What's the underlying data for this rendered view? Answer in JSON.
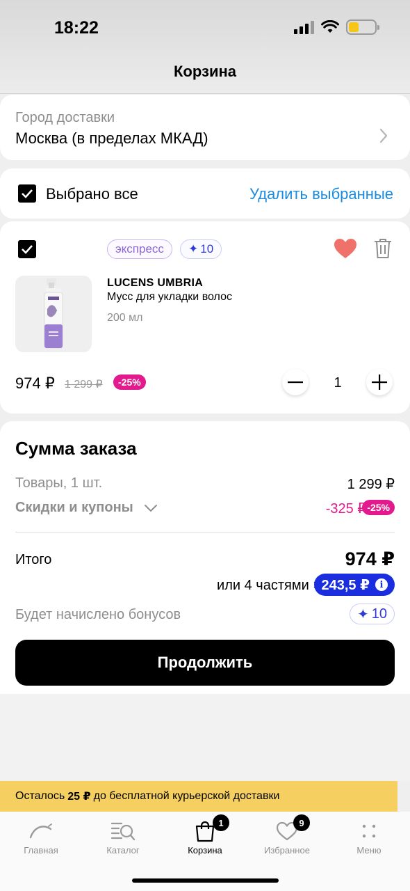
{
  "status_bar": {
    "time": "18:22"
  },
  "header": {
    "title": "Корзина"
  },
  "delivery": {
    "label": "Город доставки",
    "value": "Москва (в пределах МКАД)"
  },
  "selection": {
    "select_all_label": "Выбрано все",
    "delete_selected_label": "Удалить выбранные"
  },
  "product": {
    "tag_express": "экспресс",
    "tag_bonus": "10",
    "brand": "LUCENS UMBRIA",
    "name": "Мусс для укладки волос",
    "volume": "200 мл",
    "price": "974 ₽",
    "old_price": "1 299 ₽",
    "discount": "-25%",
    "quantity": "1",
    "favorite": true
  },
  "summary": {
    "title": "Сумма заказа",
    "goods_label": "Товары, 1 шт.",
    "goods_value": "1 299 ₽",
    "discounts_label": "Скидки и купоны",
    "discounts_value": "-325 ₽",
    "discounts_badge": "-25%",
    "total_label": "Итого",
    "total_value": "974 ₽",
    "installments_text": "или 4 частями ×",
    "installments_value": "243,5 ₽",
    "bonus_label": "Будет начислено бонусов",
    "bonus_value": "10",
    "continue_label": "Продолжить"
  },
  "banner": {
    "prefix": "Осталось",
    "amount": "25 ₽",
    "suffix": "до бесплатной курьерской доставки"
  },
  "tabs": [
    {
      "label": "Главная",
      "icon": "home-arc-icon"
    },
    {
      "label": "Каталог",
      "icon": "catalog-search-icon"
    },
    {
      "label": "Корзина",
      "icon": "bag-icon",
      "badge": "1",
      "active": true
    },
    {
      "label": "Избранное",
      "icon": "heart-icon",
      "badge": "9"
    },
    {
      "label": "Меню",
      "icon": "dots-grid-icon"
    }
  ],
  "colors": {
    "accent_blue": "#1a8be0",
    "discount_pink": "#e21a8d",
    "installment_blue": "#1a2ee0",
    "heart": "#f0716a",
    "banner_yellow": "#f5cf5f"
  }
}
